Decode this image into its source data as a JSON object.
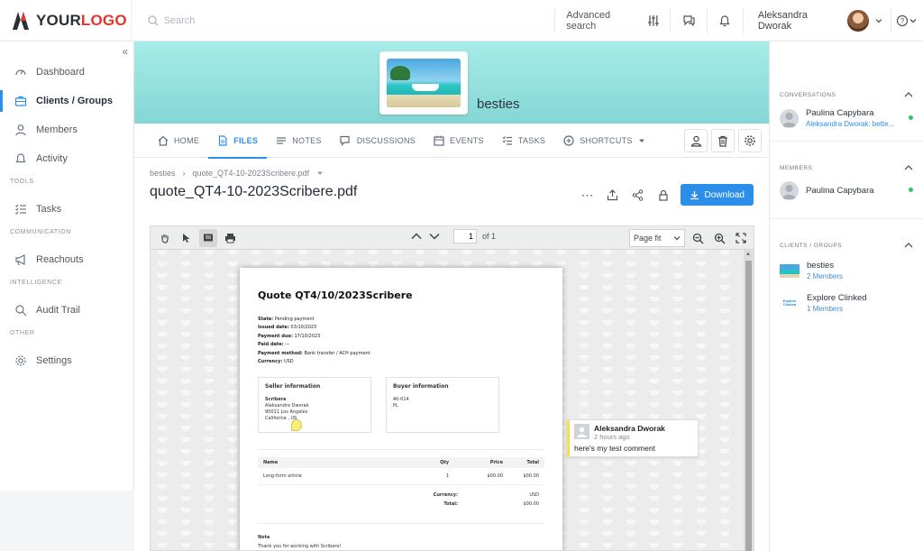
{
  "app": {
    "logo_part1": "YOUR",
    "logo_part2": "LOGO",
    "search_placeholder": "Search",
    "advanced_search": "Advanced search",
    "user_name": "Aleksandra Dworak",
    "help_label": "?"
  },
  "sidebar": {
    "items": [
      {
        "label": "Dashboard",
        "icon": "gauge-icon"
      },
      {
        "label": "Clients / Groups",
        "icon": "briefcase-icon",
        "active": true
      },
      {
        "label": "Members",
        "icon": "user-icon"
      },
      {
        "label": "Activity",
        "icon": "bell-icon"
      }
    ],
    "sections": [
      "TOOLS",
      "COMMUNICATION",
      "INTELLIGENCE",
      "OTHER"
    ],
    "tools": [
      {
        "label": "Tasks",
        "icon": "checklist-icon"
      }
    ],
    "communication": [
      {
        "label": "Reachouts",
        "icon": "megaphone-icon"
      }
    ],
    "intelligence": [
      {
        "label": "Audit Trail",
        "icon": "magnifier-icon"
      }
    ],
    "other": [
      {
        "label": "Settings",
        "icon": "gear-icon"
      }
    ]
  },
  "group": {
    "name": "besties"
  },
  "tabs": [
    {
      "label": "HOME",
      "icon": "home-icon"
    },
    {
      "label": "FILES",
      "icon": "file-icon",
      "active": true
    },
    {
      "label": "NOTES",
      "icon": "notes-icon"
    },
    {
      "label": "DISCUSSIONS",
      "icon": "discussions-icon"
    },
    {
      "label": "EVENTS",
      "icon": "calendar-icon"
    },
    {
      "label": "TASKS",
      "icon": "tasks-icon"
    },
    {
      "label": "SHORTCUTS",
      "icon": "plus-circle-icon"
    }
  ],
  "breadcrumb": {
    "root": "besties",
    "file": "quote_QT4-10-2023Scribere.pdf"
  },
  "file": {
    "title": "quote_QT4-10-2023Scribere.pdf",
    "download_label": "Download"
  },
  "viewer": {
    "page_current": "1",
    "page_of": "of 1",
    "zoom": "Page fit"
  },
  "document": {
    "title": "Quote QT4/10/2023Scribere",
    "meta": [
      {
        "label": "State:",
        "value": "Pending payment"
      },
      {
        "label": "Issued date:",
        "value": "03/10/2023"
      },
      {
        "label": "Payment due:",
        "value": "17/10/2023"
      },
      {
        "label": "Paid date:",
        "value": "—"
      },
      {
        "label": "Payment method:",
        "value": "Bank transfer / ACH payment"
      },
      {
        "label": "Currency:",
        "value": "USD"
      }
    ],
    "seller": {
      "heading": "Seller information",
      "company": "Scribere",
      "lines": [
        "Aleksandra Dworak",
        "90011 Los Angeles",
        "California , US"
      ]
    },
    "buyer": {
      "heading": "Buyer information",
      "lines": [
        "40-014",
        "PL"
      ]
    },
    "table": {
      "headers": [
        "Name",
        "Qty",
        "Price",
        "Total"
      ],
      "rows": [
        [
          "Long-form article",
          "1",
          "$00.00",
          "$00.00"
        ]
      ]
    },
    "totals": [
      {
        "label": "Currency:",
        "value": "USD"
      },
      {
        "label": "Total:",
        "value": "$00.00"
      }
    ],
    "note_heading": "Note",
    "note_text": "Thank you for working with Scribere!"
  },
  "comment": {
    "author": "Aleksandra Dworak",
    "time": "2 hours ago",
    "text": "here's my test comment"
  },
  "right_panel": {
    "conversations_heading": "CONVERSATIONS",
    "conversation": {
      "name": "Paulina Capybara",
      "preview": "Aleksandra Dworak: bette..."
    },
    "members_heading": "MEMBERS",
    "member": {
      "name": "Paulina Capybara"
    },
    "groups_heading": "CLIENTS / GROUPS",
    "groups": [
      {
        "name": "besties",
        "count": "2 Members"
      },
      {
        "name": "Explore Clinked",
        "count": "1 Members",
        "logo_text": "Explore Clinked"
      }
    ]
  },
  "colors": {
    "accent": "#2b8ee8",
    "logo_red": "#e6342c",
    "banner": "#a6ece8",
    "online": "#2ec46b"
  }
}
